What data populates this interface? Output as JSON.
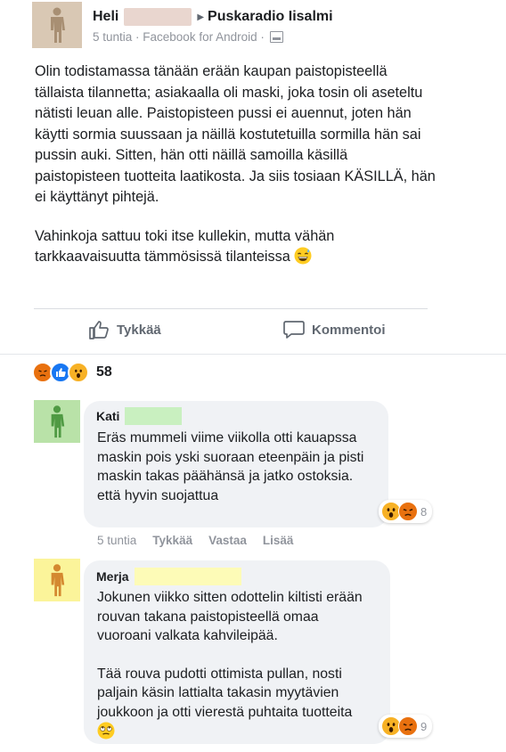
{
  "post": {
    "author": "Heli",
    "page": "Puskaradio Iisalmi",
    "meta": "5 tuntia · Facebook for Android ·",
    "paragraphs": [
      "Olin todistamassa tänään erään kaupan paistopisteellä tällaista tilannetta; asiakaalla oli maski, joka tosin oli aseteltu nätisti leuan alle. Paistopisteen pussi ei auennut, joten hän käytti sormia suussaan ja näillä kostutetuilla sormilla hän sai pussin auki. Sitten, hän otti näillä samoilla käsillä paistopisteen tuotteita laatikosta. Ja siis tosiaan KÄSILLÄ, hän ei käyttänyt pihtejä.",
      "Vahinkoja sattuu toki itse kullekin, mutta vähän tarkkaavaisuutta tämmösissä tilanteissa"
    ],
    "like_label": "Tykkää",
    "comment_label": "Kommentoi",
    "reaction_count": "58",
    "reaction_icons": [
      "angry-reaction-icon",
      "like-reaction-icon",
      "wow-reaction-icon"
    ]
  },
  "comments": [
    {
      "name": "Kati",
      "text": "Eräs mummeli viime viikolla otti kauapssa maskin pois yski suoraan eteenpäin ja pisti maskin takas päähänsä ja jatko ostoksia. että hyvin suojattua",
      "reaction_count": "8",
      "time": "5 tuntia",
      "like": "Tykkää",
      "reply": "Vastaa",
      "more": "Lisää"
    },
    {
      "name": "Merja",
      "paragraphs": [
        "Jokunen viikko sitten odottelin kiltisti erään rouvan takana paistopisteellä omaa vuoroani valkata kahvileipää.",
        "Tää rouva pudotti ottimista pullan, nosti paljain käsin lattialta takasin myytävien joukkoon ja otti vierestä puhtaita tuotteita"
      ],
      "reaction_count": "9"
    }
  ],
  "colors": {
    "accent": "#1877f2",
    "angry": "#e9710f",
    "wow": "#f7b125",
    "bubble": "#f0f2f5"
  }
}
